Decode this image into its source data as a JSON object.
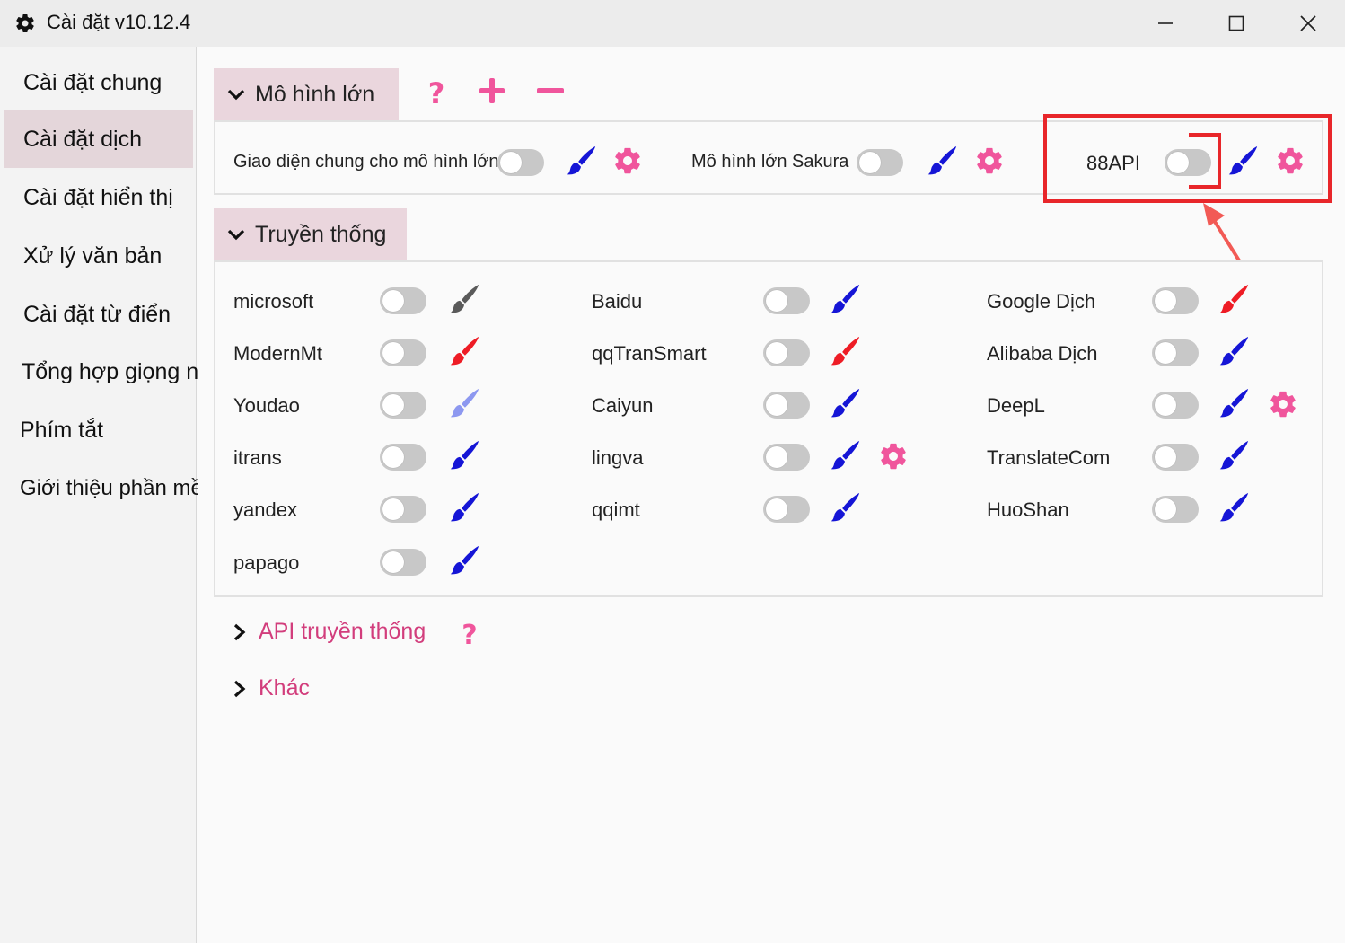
{
  "window": {
    "title": "Cài đặt v10.12.4",
    "icon": "gear-icon",
    "controls": [
      "minimize-icon",
      "maximize-icon",
      "close-icon"
    ]
  },
  "sidebar": {
    "items": [
      {
        "label": "Cài đặt chung",
        "active": false
      },
      {
        "label": "Cài đặt dịch",
        "active": true
      },
      {
        "label": "Cài đặt hiển thị",
        "active": false
      },
      {
        "label": "Xử lý văn bản",
        "active": false
      },
      {
        "label": "Cài đặt từ điển",
        "active": false
      },
      {
        "label": "Tổng hợp giọng nói",
        "active": false
      },
      {
        "label": "Phím tắt",
        "active": false
      },
      {
        "label": "Giới thiệu phần mềm",
        "active": false
      }
    ]
  },
  "large_models": {
    "header": "Mô hình lớn",
    "toolbar_icons": [
      "help-icon",
      "add-icon",
      "remove-icon"
    ],
    "items": [
      {
        "label": "Giao diện chung cho mô hình lớn",
        "enabled": false,
        "brush_color": "#1515d6",
        "has_settings": true
      },
      {
        "label": "Mô hình lớn Sakura",
        "enabled": false,
        "brush_color": "#1515d6",
        "has_settings": true
      },
      {
        "label": "88API",
        "enabled": false,
        "brush_color": "#1515d6",
        "has_settings": true
      }
    ]
  },
  "traditional": {
    "header": "Truyền thống",
    "columns": [
      [
        {
          "label": "microsoft",
          "enabled": false,
          "brush_color": "#5a5a5a",
          "has_settings": false
        },
        {
          "label": "ModernMt",
          "enabled": false,
          "brush_color": "#ee1c25",
          "has_settings": false
        },
        {
          "label": "Youdao",
          "enabled": false,
          "brush_color": "#8d98f0",
          "has_settings": false
        },
        {
          "label": "itrans",
          "enabled": false,
          "brush_color": "#1515d6",
          "has_settings": false
        },
        {
          "label": "yandex",
          "enabled": false,
          "brush_color": "#1515d6",
          "has_settings": false
        },
        {
          "label": "papago",
          "enabled": false,
          "brush_color": "#1515d6",
          "has_settings": false
        }
      ],
      [
        {
          "label": "Baidu",
          "enabled": false,
          "brush_color": "#1515d6",
          "has_settings": false
        },
        {
          "label": "qqTranSmart",
          "enabled": false,
          "brush_color": "#ee1c25",
          "has_settings": false
        },
        {
          "label": "Caiyun",
          "enabled": false,
          "brush_color": "#1515d6",
          "has_settings": false
        },
        {
          "label": "lingva",
          "enabled": false,
          "brush_color": "#1515d6",
          "has_settings": true
        },
        {
          "label": "qqimt",
          "enabled": false,
          "brush_color": "#1515d6",
          "has_settings": false
        }
      ],
      [
        {
          "label": "Google Dịch",
          "enabled": false,
          "brush_color": "#ee1c25",
          "has_settings": false
        },
        {
          "label": "Alibaba Dịch",
          "enabled": false,
          "brush_color": "#1515d6",
          "has_settings": false
        },
        {
          "label": "DeepL",
          "enabled": false,
          "brush_color": "#1515d6",
          "has_settings": true
        },
        {
          "label": "TranslateCom",
          "enabled": false,
          "brush_color": "#1515d6",
          "has_settings": false
        },
        {
          "label": "HuoShan",
          "enabled": false,
          "brush_color": "#1515d6",
          "has_settings": false
        }
      ]
    ]
  },
  "collapsed_sections": [
    {
      "label": "API truyền thống",
      "has_help": true
    },
    {
      "label": "Khác",
      "has_help": false
    }
  ],
  "colors": {
    "accent_pink": "#f0559c",
    "header_bg": "#ead6dd",
    "highlight_red": "#e8262a"
  }
}
